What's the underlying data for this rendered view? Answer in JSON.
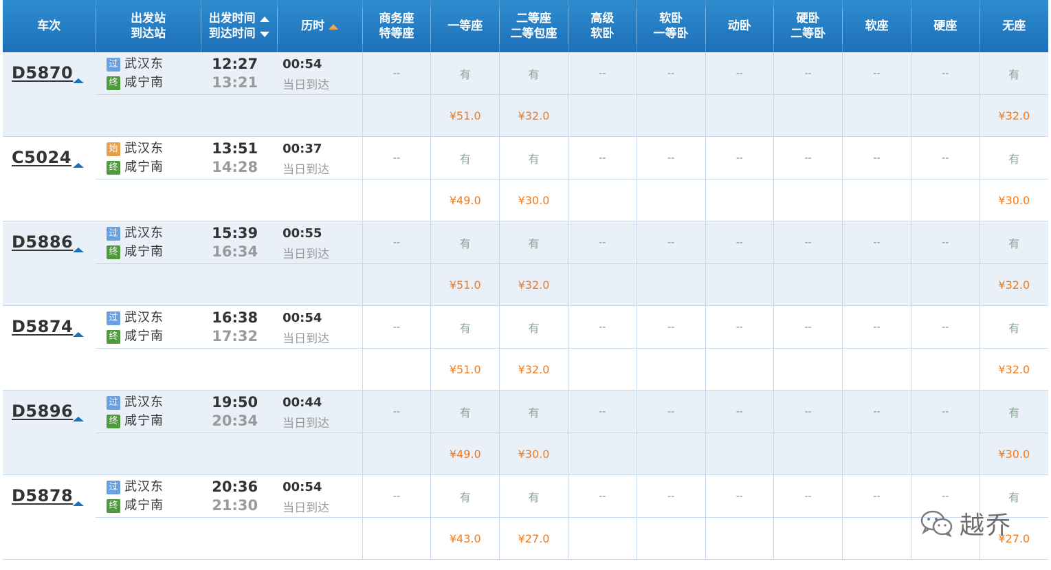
{
  "header": {
    "train": "车次",
    "stations": [
      "出发站",
      "到达站"
    ],
    "times": [
      "出发时间",
      "到达时间"
    ],
    "duration": "历时",
    "seats": [
      [
        "商务座",
        "特等座"
      ],
      [
        "一等座"
      ],
      [
        "二等座",
        "二等包座"
      ],
      [
        "高级",
        "软卧"
      ],
      [
        "软卧",
        "一等卧"
      ],
      [
        "动卧"
      ],
      [
        "硬卧",
        "二等卧"
      ],
      [
        "软座"
      ],
      [
        "硬座"
      ],
      [
        "无座"
      ]
    ]
  },
  "rows": [
    {
      "train": "D5870",
      "from_badge": "过",
      "from_type": "pass",
      "from": "武汉东",
      "to_badge": "终",
      "to": "咸宁南",
      "dep": "12:27",
      "arr": "13:21",
      "dur": "00:54",
      "day": "当日到达",
      "seats": [
        "--",
        "有",
        "有",
        "--",
        "--",
        "--",
        "--",
        "--",
        "--",
        "有"
      ],
      "prices": [
        "",
        "¥51.0",
        "¥32.0",
        "",
        "",
        "",
        "",
        "",
        "",
        "¥32.0"
      ]
    },
    {
      "train": "C5024",
      "from_badge": "始",
      "from_type": "start",
      "from": "武汉东",
      "to_badge": "终",
      "to": "咸宁南",
      "dep": "13:51",
      "arr": "14:28",
      "dur": "00:37",
      "day": "当日到达",
      "seats": [
        "--",
        "有",
        "有",
        "--",
        "--",
        "--",
        "--",
        "--",
        "--",
        "有"
      ],
      "prices": [
        "",
        "¥49.0",
        "¥30.0",
        "",
        "",
        "",
        "",
        "",
        "",
        "¥30.0"
      ]
    },
    {
      "train": "D5886",
      "from_badge": "过",
      "from_type": "pass",
      "from": "武汉东",
      "to_badge": "终",
      "to": "咸宁南",
      "dep": "15:39",
      "arr": "16:34",
      "dur": "00:55",
      "day": "当日到达",
      "seats": [
        "--",
        "有",
        "有",
        "--",
        "--",
        "--",
        "--",
        "--",
        "--",
        "有"
      ],
      "prices": [
        "",
        "¥51.0",
        "¥32.0",
        "",
        "",
        "",
        "",
        "",
        "",
        "¥32.0"
      ]
    },
    {
      "train": "D5874",
      "from_badge": "过",
      "from_type": "pass",
      "from": "武汉东",
      "to_badge": "终",
      "to": "咸宁南",
      "dep": "16:38",
      "arr": "17:32",
      "dur": "00:54",
      "day": "当日到达",
      "seats": [
        "--",
        "有",
        "有",
        "--",
        "--",
        "--",
        "--",
        "--",
        "--",
        "有"
      ],
      "prices": [
        "",
        "¥51.0",
        "¥32.0",
        "",
        "",
        "",
        "",
        "",
        "",
        "¥32.0"
      ]
    },
    {
      "train": "D5896",
      "from_badge": "过",
      "from_type": "pass",
      "from": "武汉东",
      "to_badge": "终",
      "to": "咸宁南",
      "dep": "19:50",
      "arr": "20:34",
      "dur": "00:44",
      "day": "当日到达",
      "seats": [
        "--",
        "有",
        "有",
        "--",
        "--",
        "--",
        "--",
        "--",
        "--",
        "有"
      ],
      "prices": [
        "",
        "¥49.0",
        "¥30.0",
        "",
        "",
        "",
        "",
        "",
        "",
        "¥30.0"
      ]
    },
    {
      "train": "D5878",
      "from_badge": "过",
      "from_type": "pass",
      "from": "武汉东",
      "to_badge": "终",
      "to": "咸宁南",
      "dep": "20:36",
      "arr": "21:30",
      "dur": "00:54",
      "day": "当日到达",
      "seats": [
        "--",
        "有",
        "有",
        "--",
        "--",
        "--",
        "--",
        "--",
        "--",
        "有"
      ],
      "prices": [
        "",
        "¥43.0",
        "¥27.0",
        "",
        "",
        "",
        "",
        "",
        "",
        "¥27.0"
      ]
    }
  ],
  "watermark": {
    "text": "越乔",
    "icon": "wechat-icon"
  },
  "colors": {
    "header": "#1d70b8",
    "price": "#f27a1a",
    "available": "#8aa596",
    "row_shade": "#eaf0f7"
  }
}
